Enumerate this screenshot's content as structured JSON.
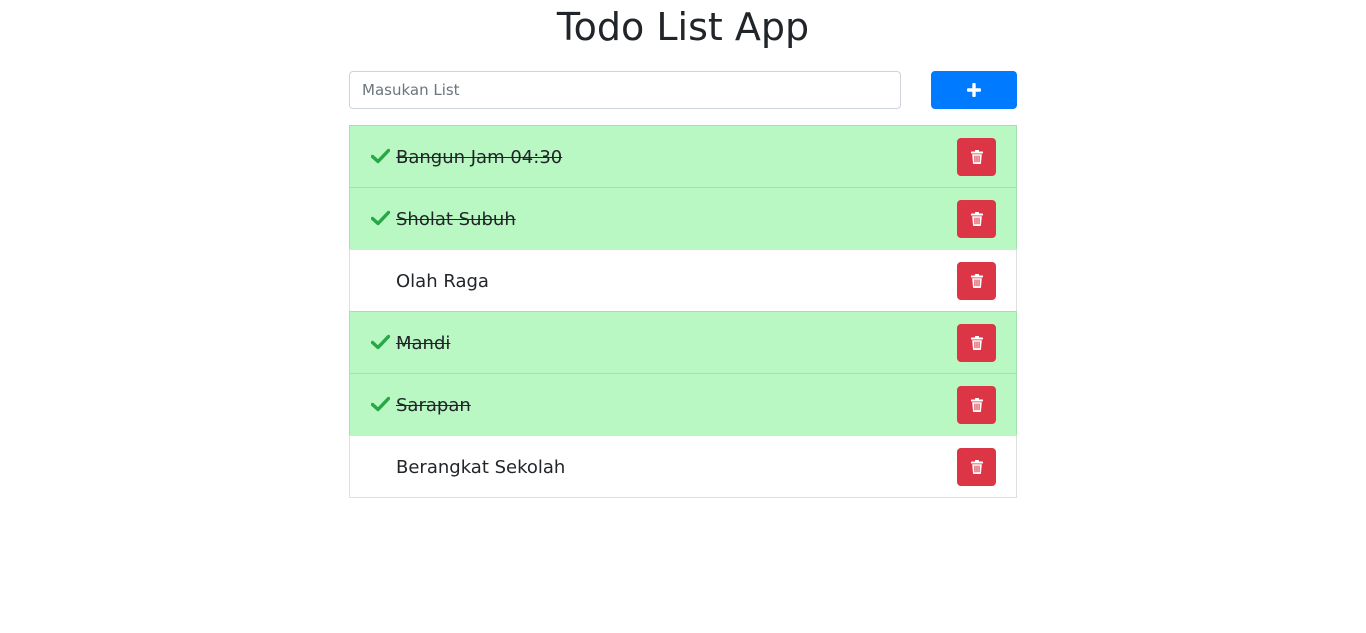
{
  "app": {
    "title": "Todo List App"
  },
  "form": {
    "input_placeholder": "Masukan List",
    "input_value": "",
    "add_icon": "plus-icon"
  },
  "colors": {
    "primary": "#007bff",
    "danger": "#dc3545",
    "done_background": "#b9f8c2",
    "check": "#28a745"
  },
  "todos": [
    {
      "text": "Bangun Jam 04:30",
      "done": true
    },
    {
      "text": "Sholat Subuh",
      "done": true
    },
    {
      "text": "Olah Raga",
      "done": false
    },
    {
      "text": "Mandi",
      "done": true
    },
    {
      "text": "Sarapan",
      "done": true
    },
    {
      "text": "Berangkat Sekolah",
      "done": false
    }
  ],
  "icons": {
    "done": "check-icon",
    "delete": "trash-icon"
  }
}
